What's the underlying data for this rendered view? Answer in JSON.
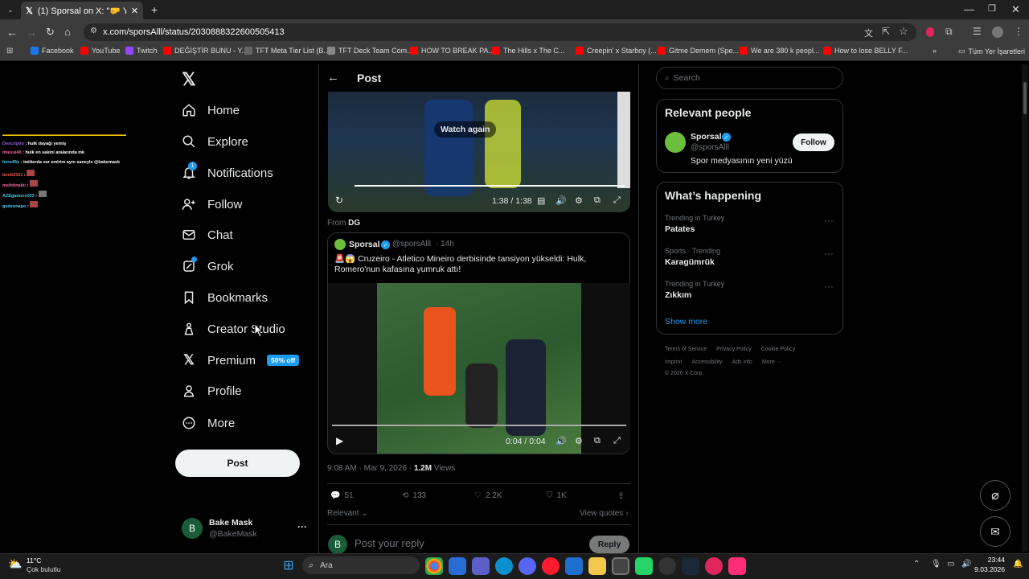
{
  "browser": {
    "tab_title": "(1) Sporsal on X: \"🤛 YUMRUK",
    "url": "x.com/sporsAlll/status/2030888322600505413",
    "bookmarks": [
      "Facebook",
      "YouTube",
      "Twitch",
      "DEĞİŞTİR BUNU - Y...",
      "TFT Meta Tier List (B...",
      "TFT Deck Team Com...",
      "HOW TO BREAK PA...",
      "The Hills x The C...",
      "Creepin' x Starboy (...",
      "Gitme Demem (Spe...",
      "We are 380 k peopl...",
      "How to lose BELLY F..."
    ],
    "all_bookmarks": "Tüm Yer İşaretleri"
  },
  "stream_chat": [
    {
      "user": "Descriptio",
      "msg": ": hulk dayağı yemiş"
    },
    {
      "user": "tmessi40",
      "msg": ": hulk en sakini aralarında mk"
    },
    {
      "user": "heru45s",
      "msg": ": twitterda var emirim aynı saneyle @bakemask"
    },
    {
      "user": "bestt2331",
      "msg": ":"
    },
    {
      "user": "mslhtinaktı",
      "msg": ":"
    },
    {
      "user": "AZEgamers033",
      "msg": ":"
    },
    {
      "user": "gedeonapo",
      "msg": ":"
    }
  ],
  "sidebar": {
    "items": [
      {
        "label": "Home",
        "icon": "home-icon"
      },
      {
        "label": "Explore",
        "icon": "search-icon"
      },
      {
        "label": "Notifications",
        "icon": "bell-icon",
        "badge": "1"
      },
      {
        "label": "Follow",
        "icon": "add-person-icon"
      },
      {
        "label": "Chat",
        "icon": "mail-icon"
      },
      {
        "label": "Grok",
        "icon": "grok-icon"
      },
      {
        "label": "Bookmarks",
        "icon": "bookmark-icon"
      },
      {
        "label": "Creator Studio",
        "icon": "creator-icon"
      },
      {
        "label": "Premium",
        "icon": "x-logo-icon",
        "badge": "50% off"
      },
      {
        "label": "Profile",
        "icon": "person-icon"
      },
      {
        "label": "More",
        "icon": "more-circle-icon"
      }
    ],
    "post_button": "Post",
    "account": {
      "name": "Bake Mask",
      "handle": "@BakeMask",
      "avatar": "B"
    }
  },
  "main": {
    "header": "Post",
    "top_video": {
      "overlay": "Watch again",
      "time": "1:38 / 1:38"
    },
    "from_label": "From",
    "from_source": "DG",
    "quoted": {
      "name": "Sporsal",
      "handle": "@sporsAlll",
      "time": "· 14h",
      "text": "🚨😱 Cruzeiro - Atletico Mineiro derbisinde tansiyon yükseldi: Hulk, Romero'nun kafasına yumruk attı!",
      "video_time": "0:04 / 0:04"
    },
    "meta": {
      "date": "9:08 AM · Mar 9, 2026 · ",
      "views": "1.2M",
      "views_label": " Views"
    },
    "actions": {
      "replies": "51",
      "reposts": "133",
      "likes": "2.2K",
      "bookmarks": "1K"
    },
    "relevant": "Relevant",
    "view_quotes": "View quotes",
    "reply_placeholder": "Post your reply",
    "reply_button": "Reply",
    "reply_avatar": "B"
  },
  "right": {
    "search_placeholder": "Search",
    "relevant_people": {
      "title": "Relevant people",
      "name": "Sporsal",
      "handle": "@sporsAlll",
      "bio": "Spor medyasının yeni yüzü",
      "follow": "Follow"
    },
    "happening": {
      "title": "What’s happening",
      "trends": [
        {
          "meta": "Trending in Turkey",
          "name": "Patates"
        },
        {
          "meta": "Sports · Trending",
          "name": "Karagümrük"
        },
        {
          "meta": "Trending in Turkey",
          "name": "Zıkkım"
        }
      ],
      "show_more": "Show more"
    },
    "footer": {
      "line1": [
        "Terms of Service",
        "Privacy Policy",
        "Cookie Policy"
      ],
      "line2": [
        "Imprint",
        "Accessibility",
        "Ads info",
        "More ···"
      ],
      "copyright": "© 2026 X Corp."
    }
  },
  "taskbar": {
    "weather_temp": "11°C",
    "weather_desc": "Çok bulutlu",
    "search": "Ara",
    "time": "23:44",
    "date": "9.03.2026"
  },
  "colors": {
    "accent": "#1d9bf0",
    "background": "#000000",
    "border": "#2f3336"
  }
}
